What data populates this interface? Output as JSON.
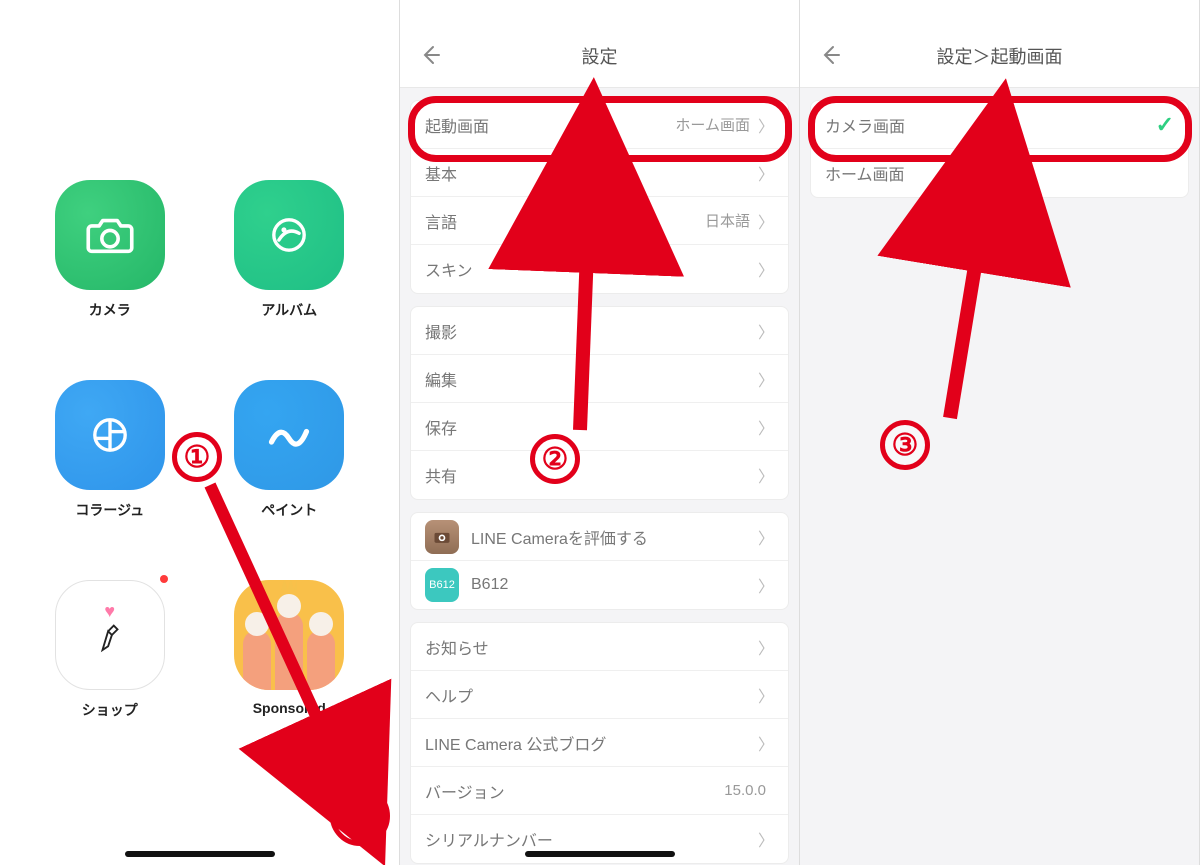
{
  "home": {
    "tiles": {
      "camera": {
        "label": "カメラ"
      },
      "album": {
        "label": "アルバム"
      },
      "collage": {
        "label": "コラージュ"
      },
      "paint": {
        "label": "ペイント"
      },
      "shop": {
        "label": "ショップ"
      },
      "sponsored": {
        "label": "Sponsored"
      }
    },
    "settings_icon": "gear-icon"
  },
  "annotations": {
    "step1": "①",
    "step2": "②",
    "step3": "③"
  },
  "settings": {
    "title": "設定",
    "groups": [
      {
        "rows": [
          {
            "label": "起動画面",
            "value": "ホーム画面"
          },
          {
            "label": "基本"
          },
          {
            "label": "言語",
            "value": "日本語"
          },
          {
            "label": "スキン"
          }
        ]
      },
      {
        "rows": [
          {
            "label": "撮影"
          },
          {
            "label": "編集"
          },
          {
            "label": "保存"
          },
          {
            "label": "共有"
          }
        ]
      },
      {
        "rows": [
          {
            "label": "LINE Cameraを評価する",
            "icon": "camera-brown"
          },
          {
            "label": "B612",
            "icon": "b612"
          }
        ]
      },
      {
        "rows": [
          {
            "label": "お知らせ"
          },
          {
            "label": "ヘルプ"
          },
          {
            "label": "LINE Camera 公式ブログ"
          },
          {
            "label": "バージョン",
            "value": "15.0.0",
            "noChevron": true
          },
          {
            "label": "シリアルナンバー"
          }
        ]
      }
    ]
  },
  "launch_screen": {
    "title": "設定＞起動画面",
    "options": [
      {
        "label": "カメラ画面",
        "selected": true
      },
      {
        "label": "ホーム画面",
        "selected": false
      }
    ]
  }
}
